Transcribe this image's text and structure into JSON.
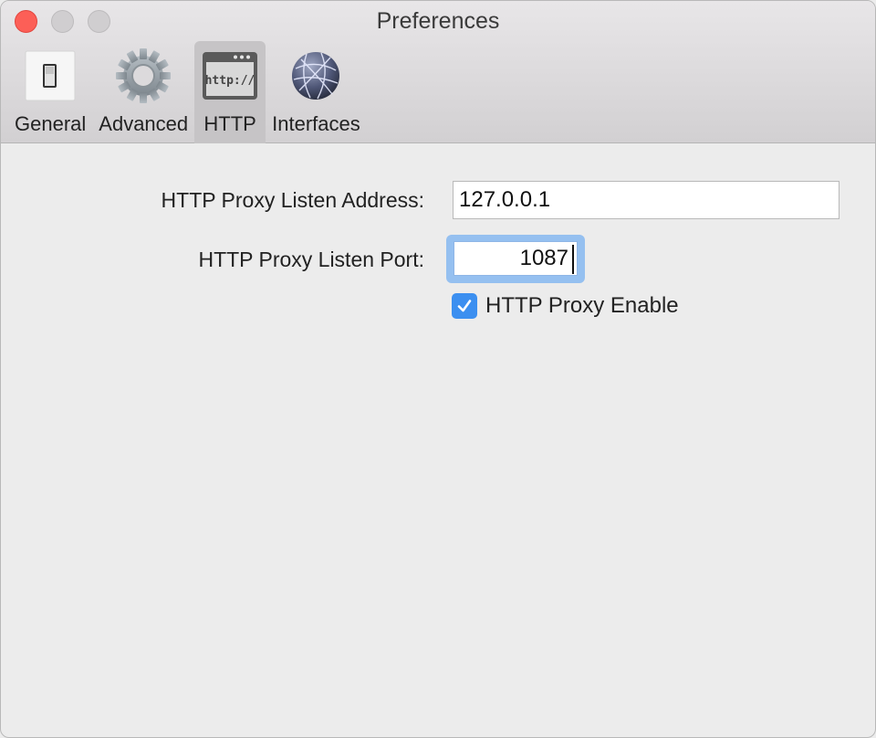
{
  "window": {
    "title": "Preferences"
  },
  "toolbar": {
    "tabs": [
      {
        "label": "General",
        "icon": "switch-icon",
        "selected": false
      },
      {
        "label": "Advanced",
        "icon": "gear-icon",
        "selected": false
      },
      {
        "label": "HTTP",
        "icon": "http-window-icon",
        "selected": true
      },
      {
        "label": "Interfaces",
        "icon": "globe-network-icon",
        "selected": false
      }
    ]
  },
  "http": {
    "address_label": "HTTP Proxy Listen Address:",
    "address_value": "127.0.0.1",
    "port_label": "HTTP Proxy Listen Port:",
    "port_value": "1087",
    "enable_label": "HTTP Proxy Enable",
    "enable_checked": true
  },
  "colors": {
    "accent": "#3c8ff0",
    "focus_ring": "#95c0f0",
    "close": "#fc5f57"
  }
}
